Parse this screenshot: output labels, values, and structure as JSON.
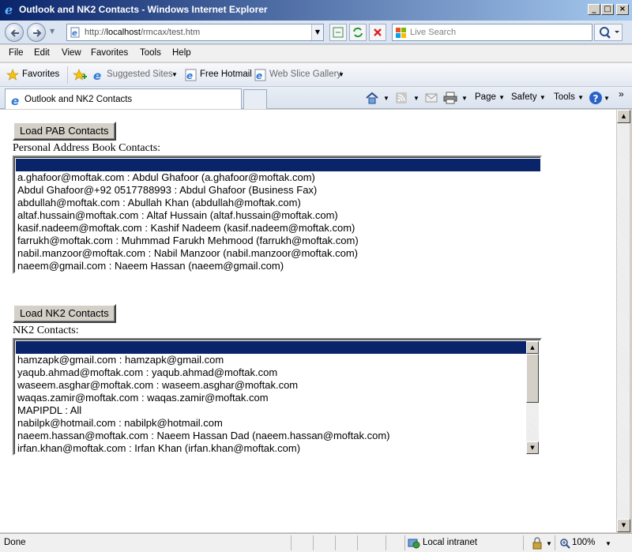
{
  "window": {
    "title": "Outlook and NK2 Contacts - Windows Internet Explorer"
  },
  "address": {
    "prefix": "http://",
    "host": "localhost",
    "path": "/rmcax/test.htm"
  },
  "search": {
    "placeholder": "Live Search"
  },
  "menu": [
    "File",
    "Edit",
    "View",
    "Favorites",
    "Tools",
    "Help"
  ],
  "favorites": {
    "label": "Favorites",
    "suggested": "Suggested Sites",
    "hotmail": "Free Hotmail",
    "webslice": "Web Slice Gallery"
  },
  "tab": {
    "label": "Outlook and NK2 Contacts"
  },
  "commands": {
    "page": "Page",
    "safety": "Safety",
    "tools": "Tools"
  },
  "pab": {
    "button": "Load PAB Contacts",
    "heading": "Personal Address Book Contacts:",
    "items": [
      "a.ghafoor@moftak.com : Abdul Ghafoor (a.ghafoor@moftak.com)",
      "Abdul Ghafoor@+92 0517788993 : Abdul Ghafoor (Business Fax)",
      "abdullah@moftak.com : Abullah Khan (abdullah@moftak.com)",
      "altaf.hussain@moftak.com : Altaf Hussain (altaf.hussain@moftak.com)",
      "kasif.nadeem@moftak.com : Kashif Nadeem (kasif.nadeem@moftak.com)",
      "farrukh@moftak.com : Muhmmad Farukh Mehmood (farrukh@moftak.com)",
      "nabil.manzoor@moftak.com : Nabil Manzoor (nabil.manzoor@moftak.com)",
      "naeem@gmail.com : Naeem Hassan (naeem@gmail.com)"
    ]
  },
  "nk2": {
    "button": "Load NK2 Contacts",
    "heading": "NK2 Contacts:",
    "items": [
      "hamzapk@gmail.com : hamzapk@gmail.com",
      "yaqub.ahmad@moftak.com : yaqub.ahmad@moftak.com",
      "waseem.asghar@moftak.com : waseem.asghar@moftak.com",
      "waqas.zamir@moftak.com : waqas.zamir@moftak.com",
      "MAPIPDL : All",
      "nabilpk@hotmail.com : nabilpk@hotmail.com",
      "naeem.hassan@moftak.com : Naeem Hassan Dad (naeem.hassan@moftak.com)",
      "irfan.khan@moftak.com : Irfan Khan (irfan.khan@moftak.com)"
    ]
  },
  "status": {
    "text": "Done",
    "zone": "Local intranet",
    "zoom": "100%"
  },
  "colors": {
    "selection": "#0a246a",
    "chrome": "#d4d0c8"
  }
}
